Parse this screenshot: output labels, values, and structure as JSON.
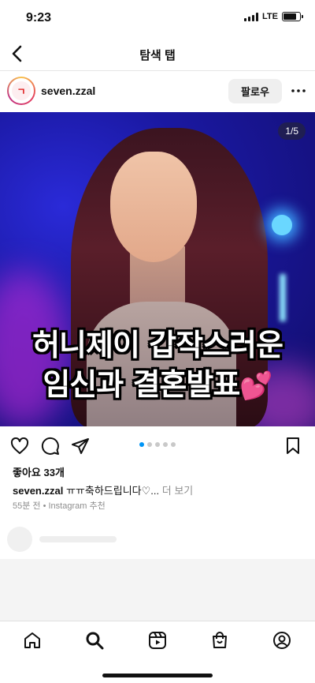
{
  "status_bar": {
    "time": "9:23",
    "network": "LTE"
  },
  "nav": {
    "title": "탐색 탭"
  },
  "post": {
    "username": "seven.zzal",
    "avatar_text": "ㄱ",
    "follow_label": "팔로우",
    "page_counter": "1/5",
    "overlay_line1": "허니제이 갑작스러운",
    "overlay_line2": "임신과 결혼발표",
    "overlay_emoji": "💕",
    "carousel": {
      "total": 5,
      "active": 1
    },
    "likes": "좋아요 33개",
    "caption_user": "seven.zzal",
    "caption_text": "ㅠㅠ축하드립니다♡...",
    "caption_more": "더 보기",
    "meta": "55분 전 • Instagram 추천"
  },
  "colors": {
    "accent": "#0095f6",
    "follow_bg": "#efefef"
  },
  "icons": [
    "back-icon",
    "more-icon",
    "heart-icon",
    "comment-icon",
    "share-icon",
    "bookmark-icon",
    "home-icon",
    "search-icon",
    "reels-icon",
    "shop-icon",
    "profile-icon"
  ]
}
